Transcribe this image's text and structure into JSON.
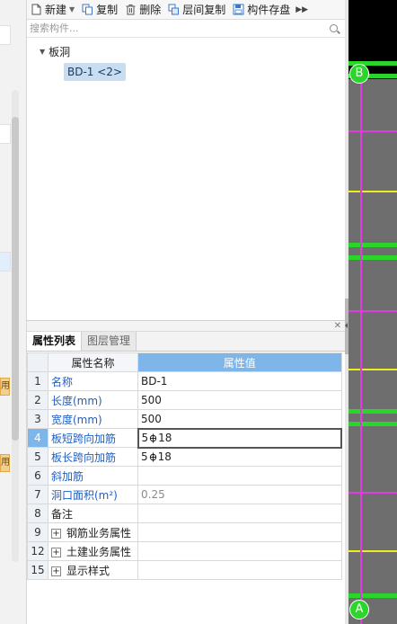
{
  "toolbar": {
    "new_label": "新建",
    "copy_label": "复制",
    "delete_label": "删除",
    "floor_copy_label": "层间复制",
    "save_component_label": "构件存盘"
  },
  "search": {
    "placeholder": "搜索构件..."
  },
  "tree": {
    "category": "板洞",
    "item": "BD-1 <2>"
  },
  "left_strip": {
    "badge_text": "用"
  },
  "properties": {
    "tabs": [
      {
        "label": "属性列表",
        "active": true
      },
      {
        "label": "图层管理",
        "active": false
      }
    ],
    "headers": {
      "name": "属性名称",
      "value": "属性值"
    },
    "rows": [
      {
        "num": "1",
        "name": "名称",
        "value": "BD-1"
      },
      {
        "num": "2",
        "name": "长度(mm)",
        "value": "500"
      },
      {
        "num": "3",
        "name": "宽度(mm)",
        "value": "500"
      },
      {
        "num": "4",
        "name": "板短跨向加筋",
        "value_pre": "5",
        "value_post": "18"
      },
      {
        "num": "5",
        "name": "板长跨向加筋",
        "value_pre": "5",
        "value_post": "18"
      },
      {
        "num": "6",
        "name": "斜加筋",
        "value": ""
      },
      {
        "num": "7",
        "name": "洞口面积(m²)",
        "value": "0.25"
      },
      {
        "num": "8",
        "name": "备注",
        "value": ""
      },
      {
        "num": "9",
        "name": "钢筋业务属性",
        "value": ""
      },
      {
        "num": "12",
        "name": "土建业务属性",
        "value": ""
      },
      {
        "num": "15",
        "name": "显示样式",
        "value": ""
      }
    ]
  },
  "canvas": {
    "axis_top": "B",
    "axis_bottom": "A",
    "colors": {
      "background": "#000000",
      "slab": "#6e6e6e",
      "green": "#2bd62b",
      "magenta": "#e33be3",
      "yellow": "#eded22"
    }
  }
}
